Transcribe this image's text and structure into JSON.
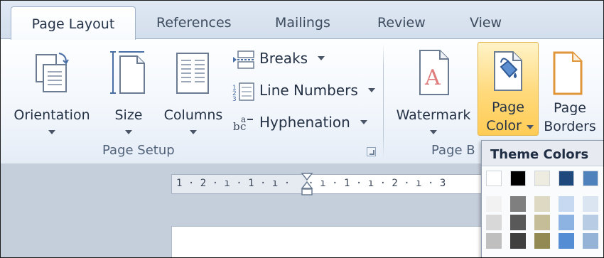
{
  "tabs": [
    {
      "label": "Page Layout",
      "active": true
    },
    {
      "label": "References"
    },
    {
      "label": "Mailings"
    },
    {
      "label": "Review"
    },
    {
      "label": "View"
    }
  ],
  "page_setup": {
    "orientation": "Orientation",
    "size": "Size",
    "columns": "Columns",
    "breaks": "Breaks",
    "line_numbers": "Line Numbers",
    "hyphenation": "Hyphenation",
    "group_label": "Page Setup"
  },
  "page_background": {
    "watermark": "Watermark",
    "page_color_line1": "Page",
    "page_color_line2": "Color",
    "page_borders_line1": "Page",
    "page_borders_line2": "Borders",
    "group_label": "Page B"
  },
  "ruler": {
    "text": "1 · 2 · ı · 1 · ı ·   · ı · 1 · ı · 2 · ı · 3"
  },
  "dropdown": {
    "header": "Theme Colors",
    "top_row": [
      "#ffffff",
      "#000000",
      "#eeece1",
      "#1f497d",
      "#4f81bd"
    ],
    "columns": [
      [
        "#f2f2f2",
        "#d8d8d8",
        "#bfbfbf"
      ],
      [
        "#7f7f7f",
        "#595959",
        "#3f3f3f"
      ],
      [
        "#ddd9c3",
        "#c4bd97",
        "#938953"
      ],
      [
        "#c6d9f0",
        "#8db3e2",
        "#548dd4"
      ],
      [
        "#dbe5f1",
        "#b8cce4",
        "#95b3d7"
      ]
    ]
  },
  "colors": {
    "ribbon_bg": "#f3f7fc",
    "highlight": "#ffd97a",
    "workspace": "#c5cedb"
  }
}
